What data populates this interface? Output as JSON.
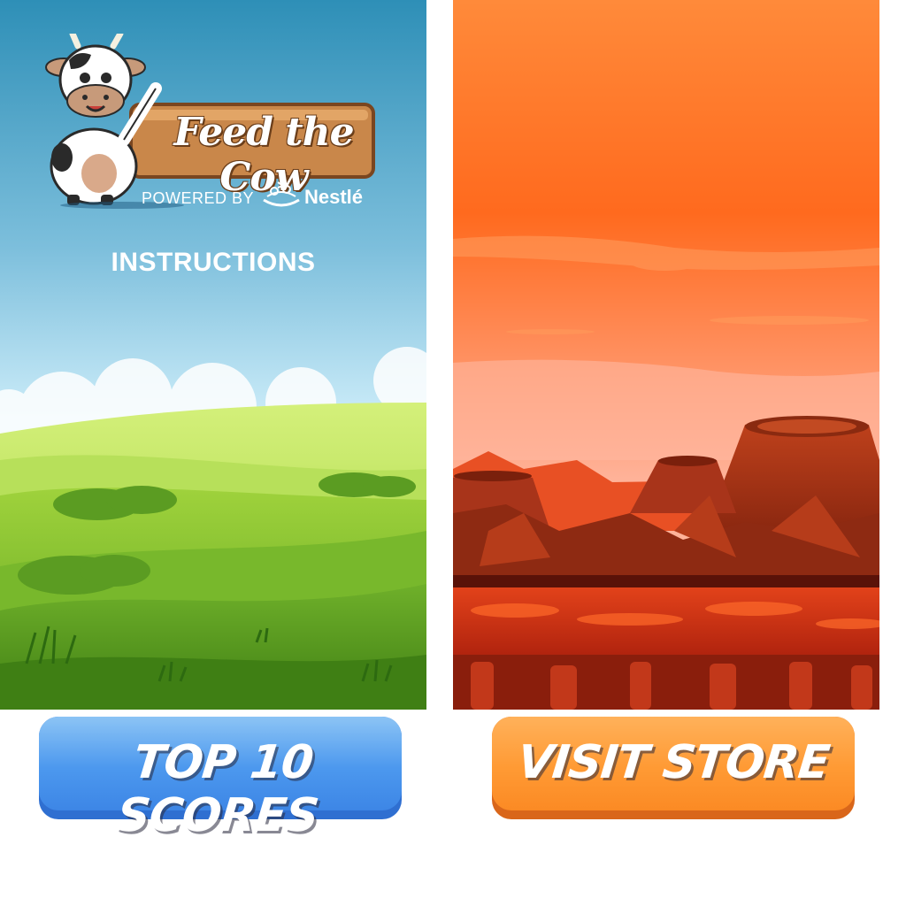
{
  "game": {
    "title": "Feed the Cow",
    "powered_by": "POWERED BY",
    "sponsor": "Nestlé",
    "instructions_label": "INSTRUCTIONS"
  },
  "buttons": {
    "top_scores": "TOP 10 SCORES",
    "visit_store": "VISIT STORE"
  },
  "colors": {
    "sky_top": "#2e8fb7",
    "sky_bottom": "#cfeefa",
    "lava_sky": "#ff6a1e",
    "top_button": "#4c98ee",
    "store_button": "#ff9a34"
  },
  "icons": {
    "mascot": "cow-mascot-icon",
    "sponsor_logo": "nestle-nest-icon"
  }
}
